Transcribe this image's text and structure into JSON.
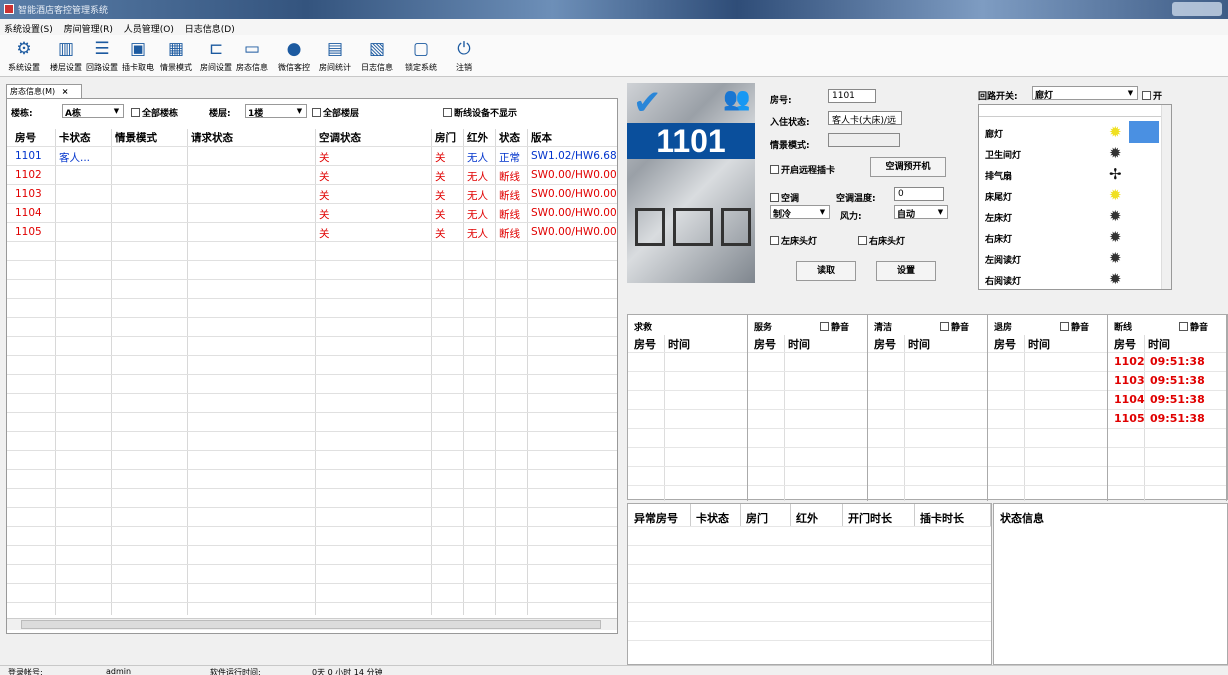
{
  "window": {
    "title": "智能酒店客控管理系统"
  },
  "menu": [
    "系统设置(S)",
    "房间管理(R)",
    "人员管理(O)",
    "日志信息(D)"
  ],
  "toolbar": [
    {
      "label": "系统设置",
      "icon": "gears-icon"
    },
    {
      "label": "楼层设置",
      "icon": "building-icon"
    },
    {
      "label": "回路设置",
      "icon": "sliders-icon"
    },
    {
      "label": "插卡取电",
      "icon": "card-icon"
    },
    {
      "label": "情景模式",
      "icon": "grid-icon"
    },
    {
      "label": "房间设置",
      "icon": "bed-icon"
    },
    {
      "label": "房态信息",
      "icon": "monitor-icon"
    },
    {
      "label": "微信客控",
      "icon": "wechat-icon"
    },
    {
      "label": "房间统计",
      "icon": "stats-icon"
    },
    {
      "label": "日志信息",
      "icon": "log-icon"
    },
    {
      "label": "锁定系统",
      "icon": "lock-icon"
    },
    {
      "label": "注销",
      "icon": "power-icon"
    }
  ],
  "tab": {
    "label": "房态信息(M)",
    "close": "×"
  },
  "filters": {
    "building_label": "楼栋:",
    "building_value": "A栋",
    "all_buildings": "全部楼栋",
    "floor_label": "楼层:",
    "floor_value": "1楼",
    "all_floors": "全部楼层",
    "hide_offline": "断线设备不显示"
  },
  "room_table": {
    "columns": [
      "房号",
      "卡状态",
      "情景模式",
      "请求状态",
      "空调状态",
      "房门",
      "红外",
      "状态",
      "版本"
    ],
    "rows": [
      {
        "room": "1101",
        "card": "客人...",
        "scene": "",
        "request": "",
        "ac": "关",
        "door": "关",
        "ir": "无人",
        "status": "正常",
        "version": "SW1.02/HW6.68",
        "online": true
      },
      {
        "room": "1102",
        "card": "",
        "scene": "",
        "request": "",
        "ac": "关",
        "door": "关",
        "ir": "无人",
        "status": "断线",
        "version": "SW0.00/HW0.00",
        "online": false
      },
      {
        "room": "1103",
        "card": "",
        "scene": "",
        "request": "",
        "ac": "关",
        "door": "关",
        "ir": "无人",
        "status": "断线",
        "version": "SW0.00/HW0.00",
        "online": false
      },
      {
        "room": "1104",
        "card": "",
        "scene": "",
        "request": "",
        "ac": "关",
        "door": "关",
        "ir": "无人",
        "status": "断线",
        "version": "SW0.00/HW0.00",
        "online": false
      },
      {
        "room": "1105",
        "card": "",
        "scene": "",
        "request": "",
        "ac": "关",
        "door": "关",
        "ir": "无人",
        "status": "断线",
        "version": "SW0.00/HW0.00",
        "online": false
      }
    ]
  },
  "room_card": {
    "number": "1101"
  },
  "room_detail": {
    "room_label": "房号:",
    "room_value": "1101",
    "checkin_label": "入住状态:",
    "checkin_value": "客人卡(大床)/远",
    "scene_label": "情景模式:",
    "scene_value": "",
    "remote_card": "开启远程插卡",
    "ac_pre": "空调预开机",
    "ac_label": "空调",
    "temp_label": "空调温度:",
    "temp_value": "0",
    "mode_value": "制冷",
    "fan_label": "风力:",
    "fan_value": "自动",
    "left_lamp": "左床头灯",
    "right_lamp": "右床头灯",
    "read_btn": "读取",
    "set_btn": "设置"
  },
  "circuit": {
    "label": "回路开关:",
    "selected": "廊灯",
    "on_label": "开",
    "items": [
      {
        "name": "廊灯",
        "icon": "bulb-on-icon",
        "on": true
      },
      {
        "name": "卫生间灯",
        "icon": "bulb-off-icon",
        "on": false
      },
      {
        "name": "排气扇",
        "icon": "fan-icon",
        "on": false
      },
      {
        "name": "床尾灯",
        "icon": "bulb-on-icon",
        "on": true
      },
      {
        "name": "左床灯",
        "icon": "bulb-off-icon",
        "on": false
      },
      {
        "name": "右床灯",
        "icon": "bulb-off-icon",
        "on": false
      },
      {
        "name": "左阅读灯",
        "icon": "bulb-off-icon",
        "on": false
      },
      {
        "name": "右阅读灯",
        "icon": "bulb-off-icon",
        "on": false
      }
    ]
  },
  "alerts": {
    "mute": "静音",
    "col_room": "房号",
    "col_time": "时间",
    "panels": [
      {
        "title": "求救",
        "mute": false,
        "rows": []
      },
      {
        "title": "服务",
        "mute": true,
        "rows": []
      },
      {
        "title": "清洁",
        "mute": true,
        "rows": []
      },
      {
        "title": "退房",
        "mute": true,
        "rows": []
      },
      {
        "title": "断线",
        "mute": true,
        "rows": [
          {
            "room": "1102",
            "time": "09:51:38"
          },
          {
            "room": "1103",
            "time": "09:51:38"
          },
          {
            "room": "1104",
            "time": "09:51:38"
          },
          {
            "room": "1105",
            "time": "09:51:38"
          }
        ]
      }
    ]
  },
  "abnormal": {
    "columns": [
      "异常房号",
      "卡状态",
      "房门",
      "红外",
      "开门时长",
      "插卡时长"
    ]
  },
  "status_info": {
    "title": "状态信息"
  },
  "statusbar": {
    "login_label": "登录帐号:",
    "login_value": "admin",
    "runtime_label": "软件运行时间:",
    "runtime_value": "0天 0 小时 14 分钟"
  }
}
